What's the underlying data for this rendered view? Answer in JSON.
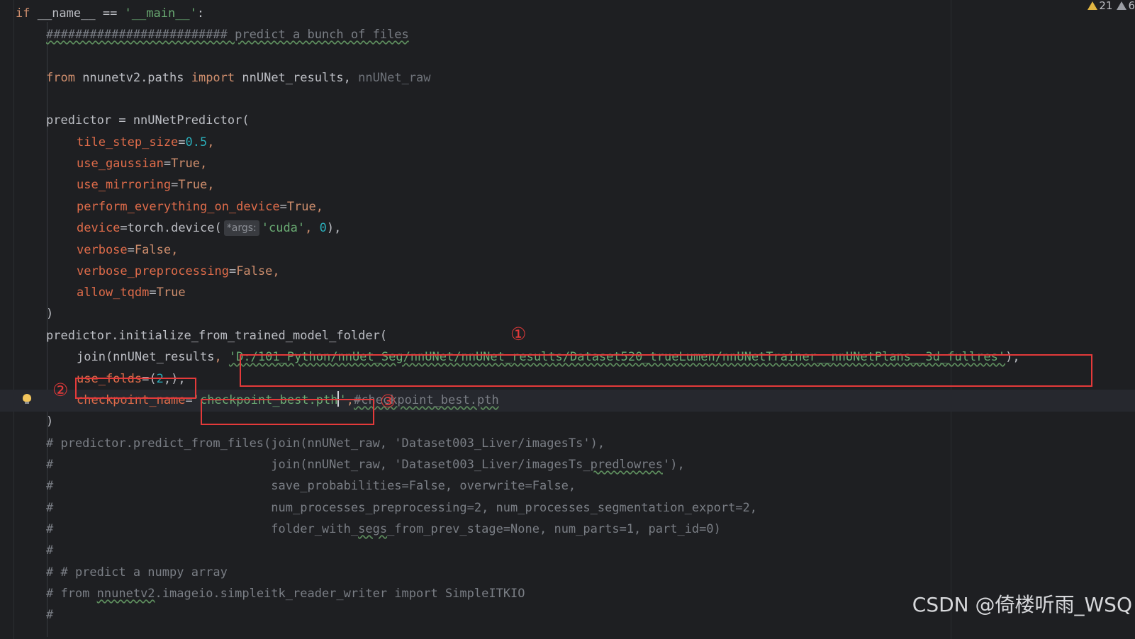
{
  "status": {
    "warning_count": "21",
    "weak_warning_count": "6"
  },
  "code": {
    "l1": {
      "t1": "if",
      "t2": " __name__ == ",
      "t3": "'__main__'",
      "t4": ":"
    },
    "l2": {
      "comment": "######################### predict a bunch of files"
    },
    "l3": {
      "t1": "from",
      "t2": " nnunetv2.paths ",
      "t3": "import",
      "t4": " nnUNet_results",
      "t5": ", ",
      "t6": "nnUNet_raw"
    },
    "l4": {
      "t1": "predictor = nnUNetPredictor("
    },
    "l5": {
      "param": "tile_step_size",
      "eq": "=",
      "val": "0.5",
      "end": ","
    },
    "l6": {
      "param": "use_gaussian",
      "eq": "=",
      "val": "True",
      "end": ","
    },
    "l7": {
      "param": "use_mirroring",
      "eq": "=",
      "val": "True",
      "end": ","
    },
    "l8": {
      "param": "perform_everything_on_device",
      "eq": "=",
      "val": "True",
      "end": ","
    },
    "l9": {
      "param": "device",
      "eq": "=",
      "call": "torch.device(",
      "hint": "*args:",
      "str": "'cuda'",
      "sep": ", ",
      "num": "0",
      "end": "),"
    },
    "l10": {
      "param": "verbose",
      "eq": "=",
      "val": "False",
      "end": ","
    },
    "l11": {
      "param": "verbose_preprocessing",
      "eq": "=",
      "val": "False",
      "end": ","
    },
    "l12": {
      "param": "allow_tqdm",
      "eq": "=",
      "val": "True"
    },
    "l13": {
      "t1": ")"
    },
    "l14": {
      "t1": "predictor.initialize_from_trained_model_folder("
    },
    "l15": {
      "t1": "join(nnUNet_results",
      "t2": ", ",
      "str": "'D:/101_Python/nnUet_Seg/nnUNet/nnUNet_results/Dataset520_trueLumen/nnUNetTrainer__nnUNetPlans__3d_fullres'",
      "end": "),"
    },
    "l16": {
      "param": "use_folds",
      "eq": "=(",
      "num": "2",
      "end": ",),"
    },
    "l17": {
      "param": "checkpoint_name",
      "eq": "=",
      "str_a": "'checkpoint_best.pth",
      "str_b": "'",
      "sep": ",",
      "comment": "#checkpoint_best.pth"
    },
    "l18": {
      "t1": ")"
    },
    "l19": {
      "comment": "# predictor.predict_from_files(join(nnUNet_raw, 'Dataset003_Liver/imagesTs'),"
    },
    "l20": {
      "comment_a": "#                              join(nnUNet_raw, 'Dataset003_Liver/imagesTs_",
      "comment_b": "predlowres",
      "comment_c": "'),"
    },
    "l21": {
      "comment": "#                              save_probabilities=False, overwrite=False,"
    },
    "l22": {
      "comment": "#                              num_processes_preprocessing=2, num_processes_segmentation_export=2,"
    },
    "l23": {
      "comment_a": "#                              folder_with_",
      "comment_b": "segs",
      "comment_c": "_from_prev_stage=None, num_parts=1, part_id=0)"
    },
    "l24": {
      "comment": "#"
    },
    "l25": {
      "comment": "# # predict a numpy array"
    },
    "l26": {
      "comment_a": "# from ",
      "comment_b": "nnunetv2",
      "comment_c": ".imageio.simpleitk_reader_writer import SimpleITKIO"
    },
    "l27": {
      "comment": "#"
    }
  },
  "annotations": {
    "marker1": "①",
    "marker2": "②",
    "marker3": "③"
  },
  "watermark": "CSDN @倚楼听雨_WSQ",
  "colors": {
    "background": "#1e1f22",
    "keyword": "#cf8e6d",
    "string": "#6aab73",
    "number": "#2aacb8",
    "parameter": "#c77dbb",
    "comment": "#7a7e85",
    "annotation_red": "#e43a3a"
  }
}
